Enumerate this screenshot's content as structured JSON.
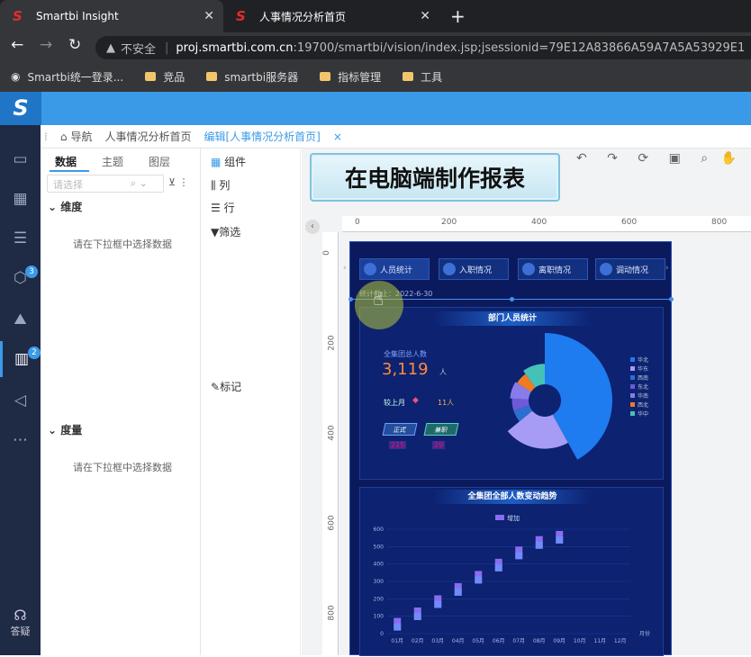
{
  "browser": {
    "tabs": [
      {
        "title": "Smartbi Insight",
        "active": true
      },
      {
        "title": "人事情况分析首页",
        "active": false
      }
    ],
    "new_tab_label": "+",
    "security_label": "不安全",
    "url_host": "proj.smartbi.com.cn",
    "url_rest": ":19700/smartbi/vision/index.jsp;jsessionid=79E12A83866A59A7A5A53929E1",
    "bookmarks": [
      "Smartbi统一登录...",
      "竞品",
      "smartbi服务器",
      "指标管理",
      "工具"
    ]
  },
  "app": {
    "logo": "S",
    "nav_badges": [
      "3",
      "2"
    ],
    "help_label": "答疑",
    "breadcrumbs": [
      "导航",
      "人事情况分析首页",
      "编辑[人事情况分析首页]"
    ],
    "close_mark": "×"
  },
  "left_panel": {
    "tabs": [
      "数据",
      "主题",
      "图层"
    ],
    "search_placeholder": "请选择",
    "dimension_title": "维度",
    "dimension_hint": "请在下拉框中选择数据",
    "measure_title": "度量",
    "measure_hint": "请在下拉框中选择数据"
  },
  "components": {
    "items": [
      "组件",
      "列",
      "行",
      "筛选",
      "标记"
    ]
  },
  "banner": {
    "text": "在电脑端制作报表"
  },
  "rulers": {
    "top": [
      "0",
      "200",
      "400",
      "600",
      "800"
    ],
    "left": [
      "0",
      "200",
      "400",
      "600",
      "800"
    ]
  },
  "dashboard": {
    "nav": [
      "人员统计",
      "入职情况",
      "离职情况",
      "调动情况"
    ],
    "date": "统计截止：2022-6-30",
    "panel1_title": "部门人员统计",
    "total_label": "全集团总人数",
    "total_value": "3,119",
    "total_unit": "人",
    "mom_label": "较上月",
    "mom_value": "11人",
    "tags": [
      "正式",
      "兼职"
    ],
    "tag_values": [
      "215",
      "29"
    ],
    "legend": [
      {
        "name": "华北",
        "color": "#1e7bf0"
      },
      {
        "name": "华东",
        "color": "#a79cf5"
      },
      {
        "name": "西南",
        "color": "#2d6fd1"
      },
      {
        "name": "东北",
        "color": "#6f59d9"
      },
      {
        "name": "华南",
        "color": "#8a7bea"
      },
      {
        "name": "西北",
        "color": "#f07b20"
      },
      {
        "name": "华中",
        "color": "#45c1b8"
      }
    ],
    "panel2_title": "全集团全部人数变动趋势"
  },
  "chart_data": {
    "type": "bar",
    "title": "全集团全部人数变动趋势",
    "series": [
      {
        "name": "增加",
        "values": [
          90,
          150,
          220,
          290,
          360,
          430,
          500,
          560,
          590,
          null,
          null,
          null
        ]
      }
    ],
    "categories": [
      "01月",
      "02月",
      "03月",
      "04月",
      "05月",
      "06月",
      "07月",
      "08月",
      "09月",
      "10月",
      "11月",
      "12月"
    ],
    "xlabel": "月份",
    "ylabel": "",
    "yticks": [
      "0",
      "100",
      "200",
      "300",
      "400",
      "500",
      "600"
    ],
    "ylim": [
      0,
      600
    ],
    "bar_color": "#8a6cf0"
  },
  "pie_data": {
    "type": "pie",
    "slices": [
      {
        "name": "华北",
        "value": 42
      },
      {
        "name": "华东",
        "value": 22
      },
      {
        "name": "西南",
        "value": 6
      },
      {
        "name": "东北",
        "value": 6
      },
      {
        "name": "华南",
        "value": 8
      },
      {
        "name": "西北",
        "value": 6
      },
      {
        "name": "华中",
        "value": 10
      }
    ]
  }
}
